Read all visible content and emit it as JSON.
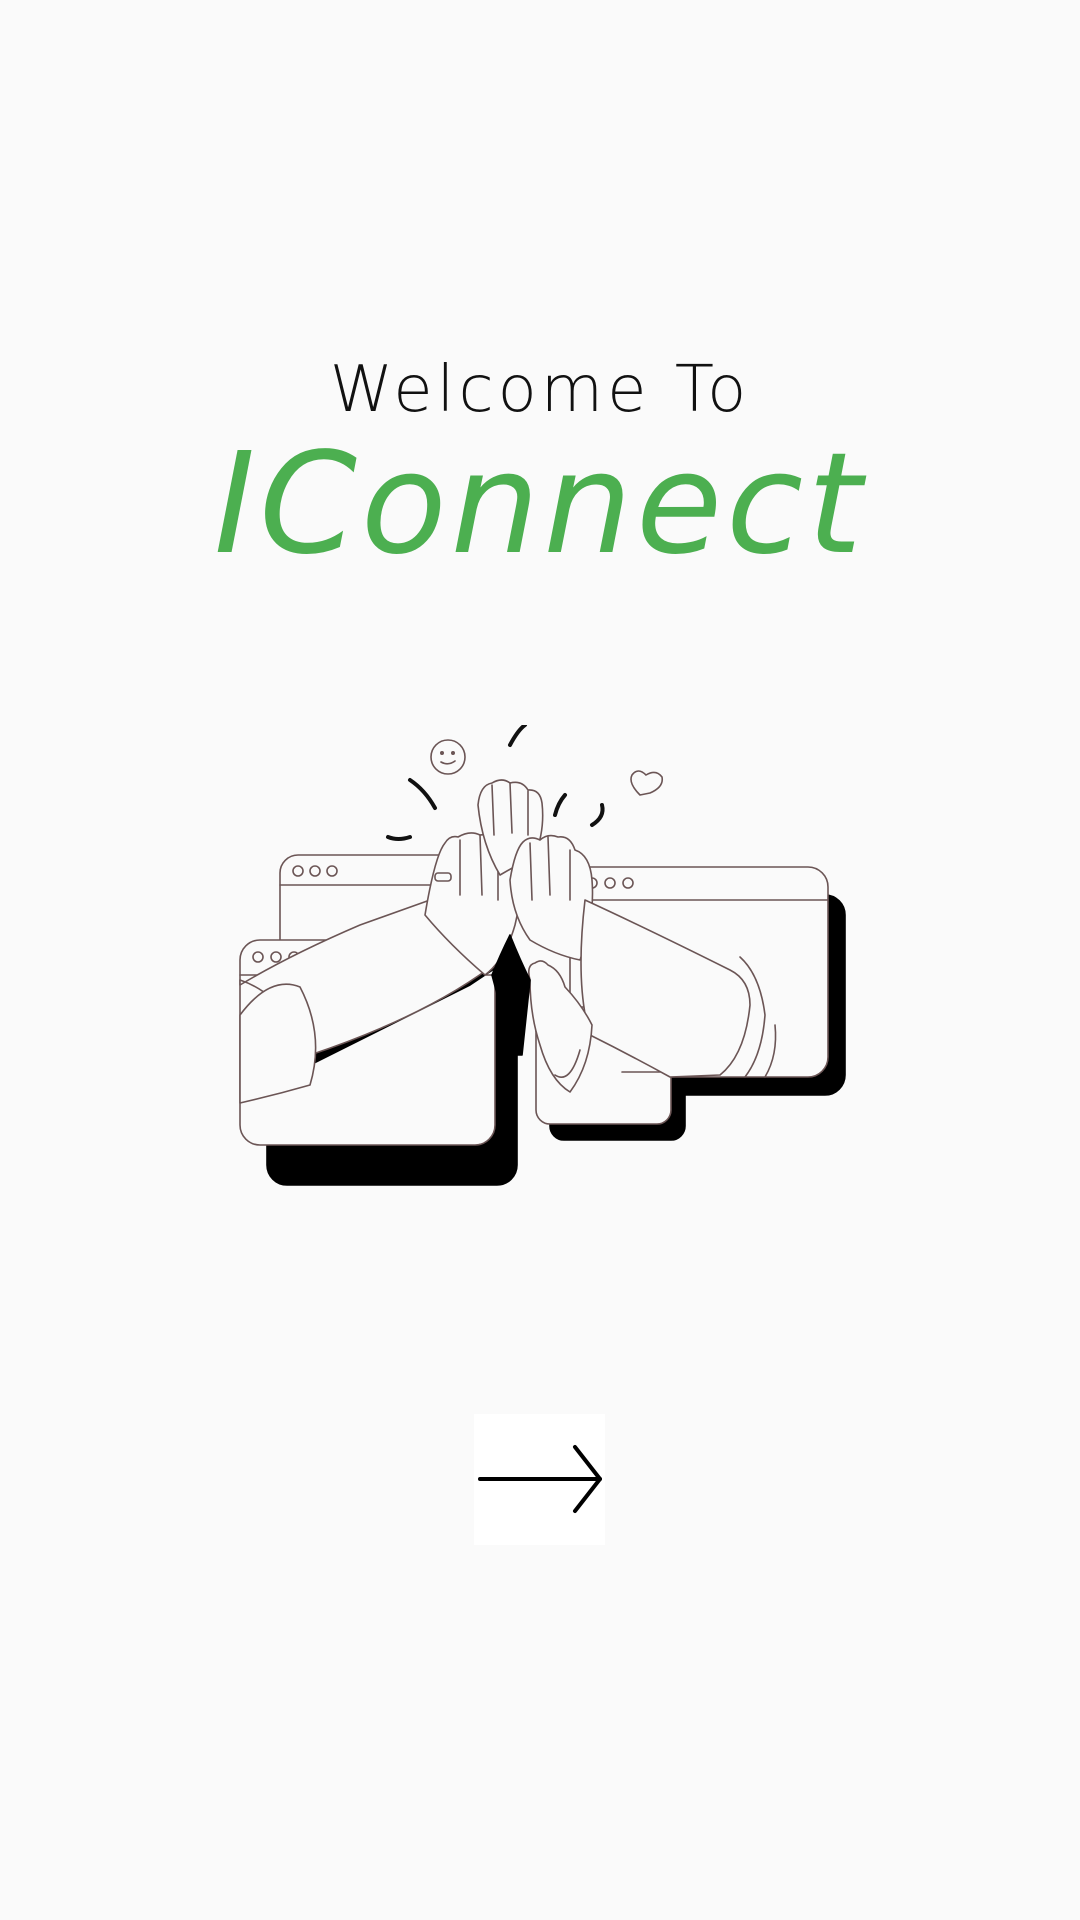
{
  "welcome": {
    "line1": "Welcome To",
    "app_name": "IConnect"
  },
  "colors": {
    "background": "#fafafa",
    "accent": "#4caf50",
    "text": "#111111"
  },
  "illustration": {
    "icon": "high-five-illustration"
  },
  "next_button": {
    "icon": "arrow-right-icon"
  }
}
